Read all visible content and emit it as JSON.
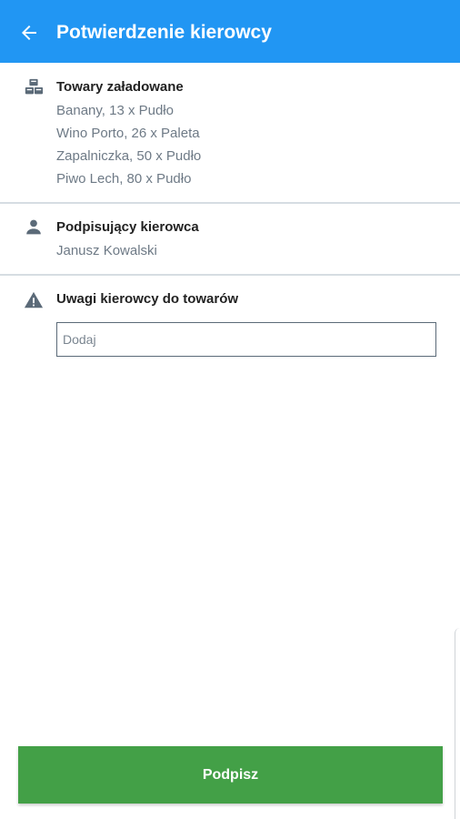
{
  "appbar": {
    "title": "Potwierdzenie kierowcy",
    "back_icon": "arrow-left-icon",
    "color": "#2196f3"
  },
  "goods": {
    "icon": "boxes-icon",
    "title": "Towary załadowane",
    "items": [
      "Banany, 13 x Pudło",
      "Wino Porto, 26 x Paleta",
      "Zapalniczka, 50 x Pudło",
      "Piwo Lech, 80 x Pudło"
    ]
  },
  "driver": {
    "icon": "person-icon",
    "title": "Podpisujący kierowca",
    "name": "Janusz Kowalski"
  },
  "remarks": {
    "icon": "warning-icon",
    "title": "Uwagi kierowcy do towarów",
    "placeholder": "Dodaj",
    "value": ""
  },
  "action": {
    "label": "Podpisz",
    "color": "#43a047"
  }
}
